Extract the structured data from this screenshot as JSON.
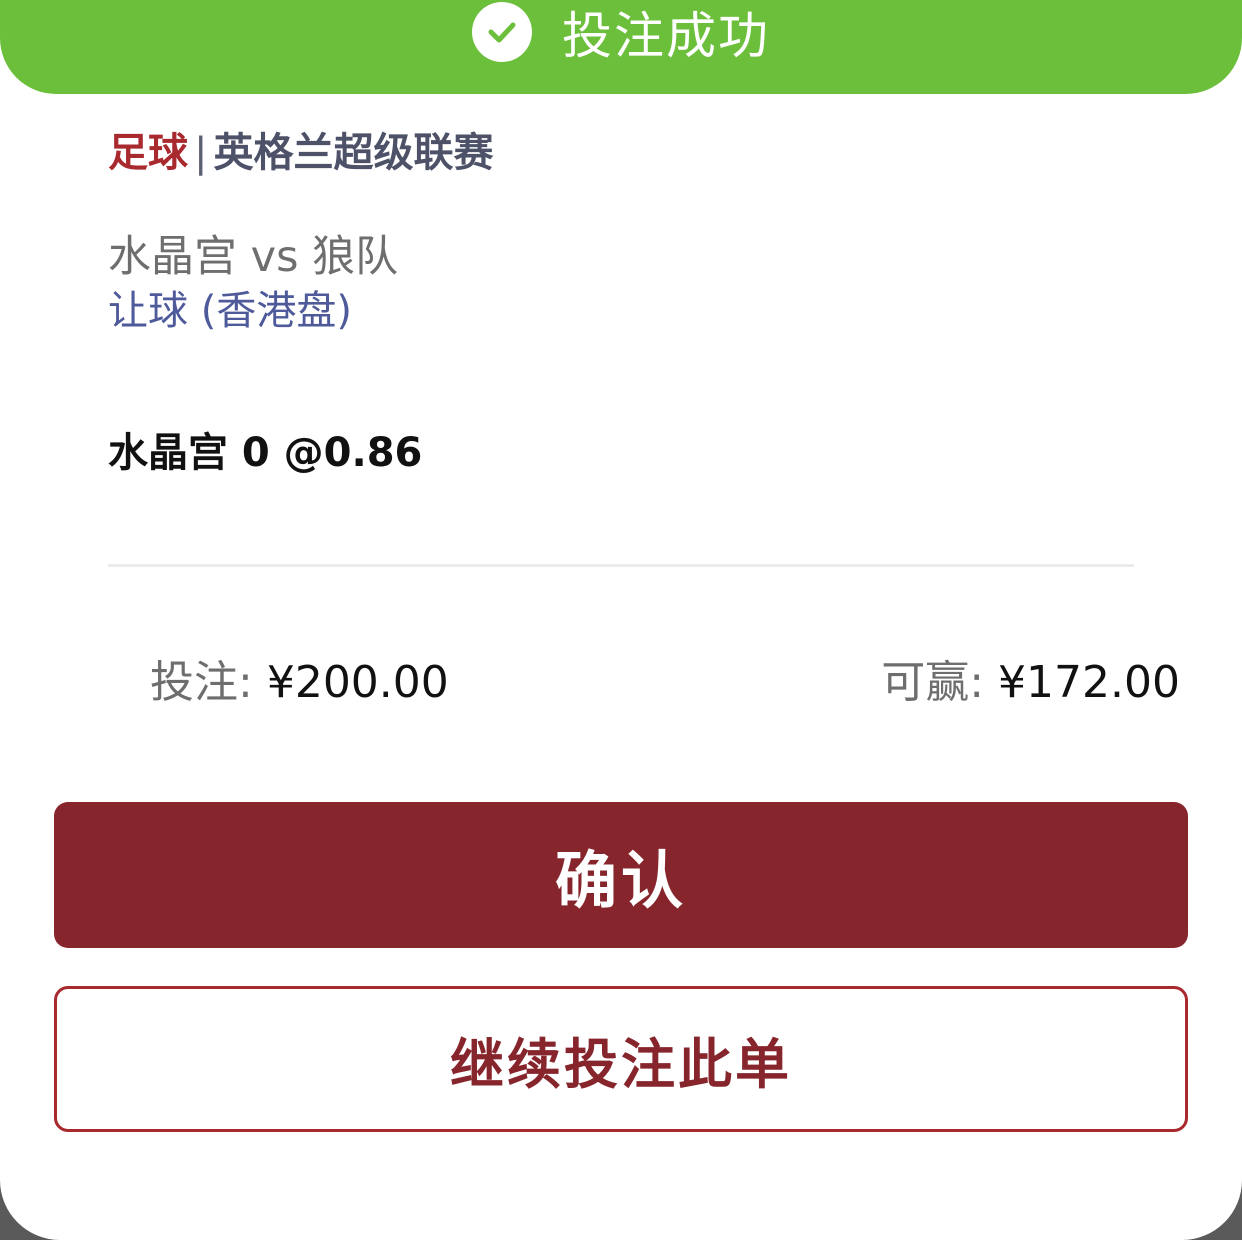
{
  "banner": {
    "status_icon": "check-circle-icon",
    "text": "投注成功",
    "color": "#6bbf3b"
  },
  "bet": {
    "sport": "足球",
    "separator": "|",
    "league": "英格兰超级联赛",
    "match": "水晶宫 vs 狼队",
    "market": "让球 (香港盘)",
    "selection": "水晶宫 0 @0.86"
  },
  "summary": {
    "stake_label": "投注:",
    "stake_value": "¥200.00",
    "payout_label": "可赢:",
    "payout_value": "¥172.00"
  },
  "actions": {
    "confirm_label": "确认",
    "continue_label": "继续投注此单",
    "accent_color": "#87252c"
  }
}
